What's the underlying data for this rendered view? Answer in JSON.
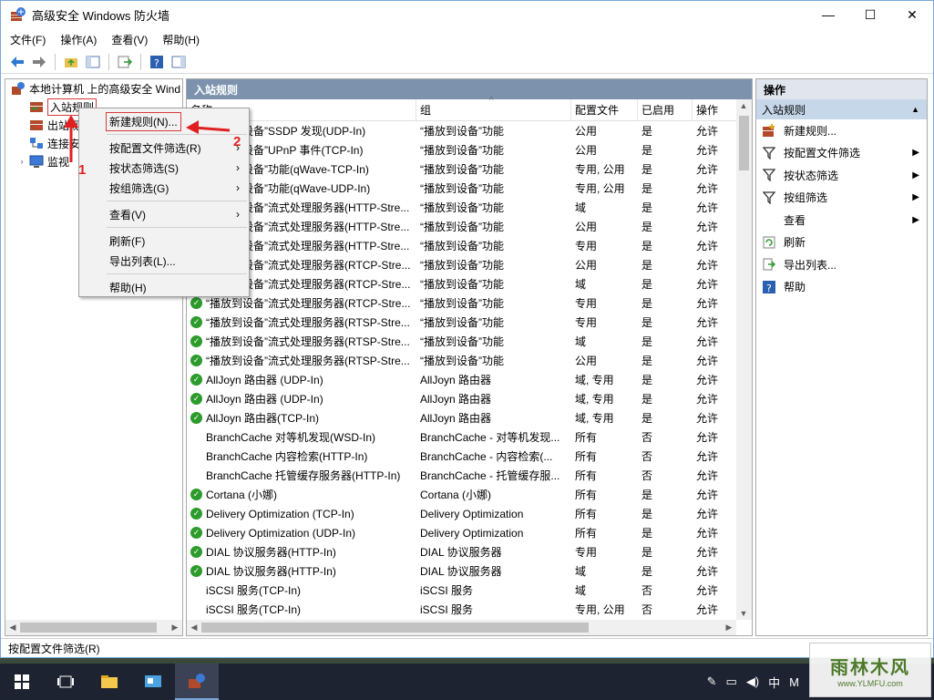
{
  "window": {
    "title": "高级安全 Windows 防火墙",
    "min": "—",
    "max": "☐",
    "close": "✕"
  },
  "menu": [
    "文件(F)",
    "操作(A)",
    "查看(V)",
    "帮助(H)"
  ],
  "tree": {
    "root": "本地计算机 上的高级安全 Wind",
    "inbound": "入站规则",
    "outbound": "出站规",
    "connsec": "连接安",
    "monitor": "监视"
  },
  "middle": {
    "title": "入站规则",
    "columns": [
      "名称",
      "组",
      "配置文件",
      "已启用",
      "操作"
    ],
    "rows": [
      {
        "c": true,
        "name": "“播放到设备”SSDP 发现(UDP-In)",
        "group": "“播放到设备”功能",
        "prof": "公用",
        "en": "是",
        "act": "允许"
      },
      {
        "c": true,
        "name": "“播放到设备”UPnP 事件(TCP-In)",
        "group": "“播放到设备”功能",
        "prof": "公用",
        "en": "是",
        "act": "允许"
      },
      {
        "c": true,
        "name": "“播放到设备”功能(qWave-TCP-In)",
        "group": "“播放到设备”功能",
        "prof": "专用, 公用",
        "en": "是",
        "act": "允许"
      },
      {
        "c": true,
        "name": "“播放到设备”功能(qWave-UDP-In)",
        "group": "“播放到设备”功能",
        "prof": "专用, 公用",
        "en": "是",
        "act": "允许"
      },
      {
        "c": true,
        "name": "“播放到设备”流式处理服务器(HTTP-Stre...",
        "group": "“播放到设备”功能",
        "prof": "域",
        "en": "是",
        "act": "允许"
      },
      {
        "c": true,
        "name": "“播放到设备”流式处理服务器(HTTP-Stre...",
        "group": "“播放到设备”功能",
        "prof": "公用",
        "en": "是",
        "act": "允许"
      },
      {
        "c": true,
        "name": "“播放到设备”流式处理服务器(HTTP-Stre...",
        "group": "“播放到设备”功能",
        "prof": "专用",
        "en": "是",
        "act": "允许"
      },
      {
        "c": true,
        "name": "“播放到设备”流式处理服务器(RTCP-Stre...",
        "group": "“播放到设备”功能",
        "prof": "公用",
        "en": "是",
        "act": "允许"
      },
      {
        "c": true,
        "name": "“播放到设备”流式处理服务器(RTCP-Stre...",
        "group": "“播放到设备”功能",
        "prof": "域",
        "en": "是",
        "act": "允许"
      },
      {
        "c": true,
        "name": "“播放到设备”流式处理服务器(RTCP-Stre...",
        "group": "“播放到设备”功能",
        "prof": "专用",
        "en": "是",
        "act": "允许"
      },
      {
        "c": true,
        "name": "“播放到设备”流式处理服务器(RTSP-Stre...",
        "group": "“播放到设备”功能",
        "prof": "专用",
        "en": "是",
        "act": "允许"
      },
      {
        "c": true,
        "name": "“播放到设备”流式处理服务器(RTSP-Stre...",
        "group": "“播放到设备”功能",
        "prof": "域",
        "en": "是",
        "act": "允许"
      },
      {
        "c": true,
        "name": "“播放到设备”流式处理服务器(RTSP-Stre...",
        "group": "“播放到设备”功能",
        "prof": "公用",
        "en": "是",
        "act": "允许"
      },
      {
        "c": true,
        "name": "AllJoyn 路由器 (UDP-In)",
        "group": "AllJoyn 路由器",
        "prof": "域, 专用",
        "en": "是",
        "act": "允许"
      },
      {
        "c": true,
        "name": "AllJoyn 路由器 (UDP-In)",
        "group": "AllJoyn 路由器",
        "prof": "域, 专用",
        "en": "是",
        "act": "允许"
      },
      {
        "c": true,
        "name": "AllJoyn 路由器(TCP-In)",
        "group": "AllJoyn 路由器",
        "prof": "域, 专用",
        "en": "是",
        "act": "允许"
      },
      {
        "c": false,
        "name": "BranchCache 对等机发现(WSD-In)",
        "group": "BranchCache - 对等机发现...",
        "prof": "所有",
        "en": "否",
        "act": "允许"
      },
      {
        "c": false,
        "name": "BranchCache 内容检索(HTTP-In)",
        "group": "BranchCache - 内容检索(...",
        "prof": "所有",
        "en": "否",
        "act": "允许"
      },
      {
        "c": false,
        "name": "BranchCache 托管缓存服务器(HTTP-In)",
        "group": "BranchCache - 托管缓存服...",
        "prof": "所有",
        "en": "否",
        "act": "允许"
      },
      {
        "c": true,
        "name": "Cortana (小娜)",
        "group": "Cortana (小娜)",
        "prof": "所有",
        "en": "是",
        "act": "允许"
      },
      {
        "c": true,
        "name": "Delivery Optimization (TCP-In)",
        "group": "Delivery Optimization",
        "prof": "所有",
        "en": "是",
        "act": "允许"
      },
      {
        "c": true,
        "name": "Delivery Optimization (UDP-In)",
        "group": "Delivery Optimization",
        "prof": "所有",
        "en": "是",
        "act": "允许"
      },
      {
        "c": true,
        "name": "DIAL 协议服务器(HTTP-In)",
        "group": "DIAL 协议服务器",
        "prof": "专用",
        "en": "是",
        "act": "允许"
      },
      {
        "c": true,
        "name": "DIAL 协议服务器(HTTP-In)",
        "group": "DIAL 协议服务器",
        "prof": "域",
        "en": "是",
        "act": "允许"
      },
      {
        "c": false,
        "name": "iSCSI 服务(TCP-In)",
        "group": "iSCSI 服务",
        "prof": "域",
        "en": "否",
        "act": "允许"
      },
      {
        "c": false,
        "name": "iSCSI 服务(TCP-In)",
        "group": "iSCSI 服务",
        "prof": "专用, 公用",
        "en": "否",
        "act": "允许"
      }
    ]
  },
  "actions": {
    "title": "操作",
    "section": "入站规则",
    "items": [
      {
        "icon": "new-rule-icon",
        "label": "新建规则...",
        "arrow": false
      },
      {
        "icon": "filter-icon",
        "label": "按配置文件筛选",
        "arrow": true
      },
      {
        "icon": "filter-icon",
        "label": "按状态筛选",
        "arrow": true
      },
      {
        "icon": "filter-icon",
        "label": "按组筛选",
        "arrow": true
      },
      {
        "icon": "",
        "label": "查看",
        "arrow": true
      },
      {
        "icon": "refresh-icon",
        "label": "刷新",
        "arrow": false
      },
      {
        "icon": "export-icon",
        "label": "导出列表...",
        "arrow": false
      },
      {
        "icon": "help-icon",
        "label": "帮助",
        "arrow": false
      }
    ]
  },
  "context_menu": {
    "new_rule": "新建规则(N)...",
    "filter_profile": "按配置文件筛选(R)",
    "filter_state": "按状态筛选(S)",
    "filter_group": "按组筛选(G)",
    "view": "查看(V)",
    "refresh": "刷新(F)",
    "export": "导出列表(L)...",
    "help": "帮助(H)"
  },
  "status": "按配置文件筛选(R)",
  "annotations": {
    "one": "1",
    "two": "2"
  },
  "tray": {
    "ime": "中",
    "m": "M"
  },
  "watermark": {
    "big": "雨林木风",
    "small": "www.YLMFU.com"
  },
  "colors": {
    "accent": "#7d93ad",
    "check": "#2c9b2c",
    "annot": "#e02020"
  }
}
